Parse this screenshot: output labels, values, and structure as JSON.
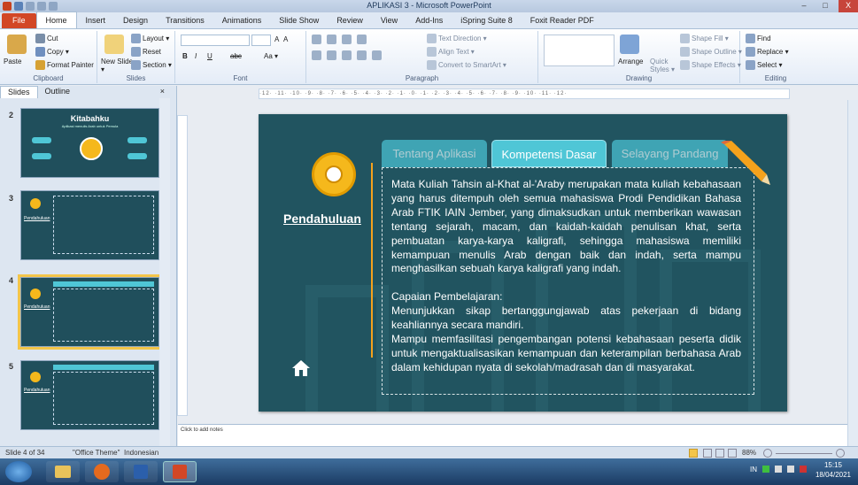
{
  "window": {
    "title": "APLIKASI 3  -  Microsoft PowerPoint",
    "controls": {
      "minimize": "–",
      "maximize": "□",
      "close": "X"
    }
  },
  "ribbon_tabs": [
    "File",
    "Home",
    "Insert",
    "Design",
    "Transitions",
    "Animations",
    "Slide Show",
    "Review",
    "View",
    "Add-Ins",
    "iSpring Suite 8",
    "Foxit Reader PDF"
  ],
  "ribbon": {
    "clipboard": {
      "paste": "Paste",
      "cut": "Cut",
      "copy": "Copy ▾",
      "format_painter": "Format Painter",
      "label": "Clipboard"
    },
    "slides": {
      "new_slide": "New Slide ▾",
      "layout": "Layout ▾",
      "reset": "Reset",
      "section": "Section ▾",
      "label": "Slides"
    },
    "font": {
      "bold": "B",
      "italic": "I",
      "underline": "U",
      "strike": "abc",
      "size_up": "A",
      "size_down": "A",
      "clear": "Aa ▾",
      "label": "Font"
    },
    "paragraph": {
      "text_direction": "Text Direction ▾",
      "align_text": "Align Text ▾",
      "smartart": "Convert to SmartArt ▾",
      "label": "Paragraph"
    },
    "drawing": {
      "arrange": "Arrange",
      "quick_styles": "Quick Styles ▾",
      "shape_fill": "Shape Fill ▾",
      "shape_outline": "Shape Outline ▾",
      "shape_effects": "Shape Effects ▾",
      "label": "Drawing"
    },
    "editing": {
      "find": "Find",
      "replace": "Replace ▾",
      "select": "Select ▾",
      "label": "Editing"
    }
  },
  "left_pane": {
    "tabs": [
      "Slides",
      "Outline"
    ],
    "close": "×",
    "thumbs": [
      {
        "num": "2",
        "title": "Kitabahku",
        "subtitle": "Aplikasi menulis Arab untuk Pemula"
      },
      {
        "num": "3",
        "title": "Pendahuluan"
      },
      {
        "num": "4",
        "title": "Pendahuluan"
      },
      {
        "num": "5",
        "title": "Pendahuluan"
      }
    ]
  },
  "ruler": "·12· ·11· ·10· ·9· ·8· ·7· ·6· ·5· ·4· ·3· ·2· ·1· ·0· ·1· ·2· ·3· ·4· ·5· ·6· ·7· ·8· ·9· ·10· ·11· ·12·",
  "slide": {
    "side_title": "Pendahuluan",
    "tabs": [
      "Tentang Aplikasi",
      "Kompetensi Dasar",
      "Selayang Pandang"
    ],
    "active_tab": "Kompetensi Dasar",
    "paragraph1": "Mata Kuliah Tahsin al-Khat al-'Araby merupakan mata kuliah kebahasaan yang harus ditempuh oleh semua mahasiswa Prodi Pendidikan Bahasa Arab FTIK IAIN Jember, yang dimaksudkan untuk memberikan wawasan tentang sejarah, macam, dan kaidah-kaidah penulisan khat, serta pembuatan karya-karya kaligrafi, sehingga mahasiswa memiliki kemampuan menulis Arab dengan baik dan indah, serta mampu menghasilkan sebuah karya kaligrafi yang indah.",
    "heading2": "Capaian Pembelajaran:",
    "paragraph2": "Menunjukkan sikap bertanggungjawab atas pekerjaan di bidang keahliannya secara mandiri.",
    "paragraph3": "Mampu memfasilitasi pengembangan potensi kebahasaan peserta didik untuk mengaktualisasikan kemampuan dan keterampilan berbahasa Arab dalam kehidupan nyata di sekolah/madrasah dan di masyarakat."
  },
  "notes_placeholder": "Click to add notes",
  "status": {
    "slide_of": "Slide 4 of 34",
    "theme": "\"Office Theme\"",
    "language": "Indonesian",
    "zoom": "88%"
  },
  "taskbar": {
    "lang": "IN",
    "time": "15:15",
    "date": "18/04/2021"
  },
  "colors": {
    "slide_bg": "#215460",
    "accent": "#f5b81c",
    "tab": "#4fc6d6",
    "file_tab": "#d24726"
  }
}
